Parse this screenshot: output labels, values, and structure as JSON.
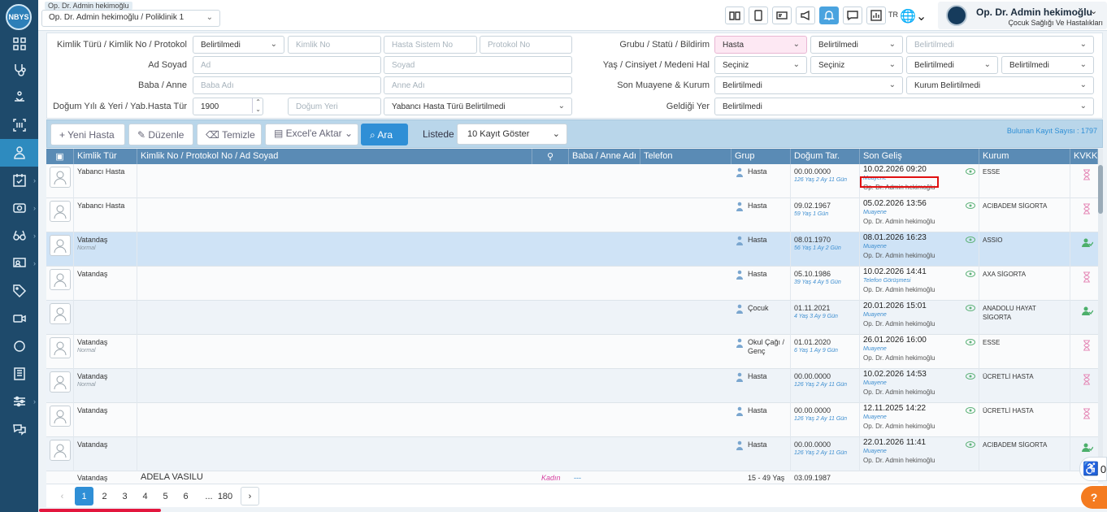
{
  "app": {
    "logo": "NBYS"
  },
  "topbar": {
    "crumb": "Op. Dr. Admin hekimoğlu",
    "poliklinik": "Op. Dr. Admin hekimoğlu / Poliklinik 1",
    "lang": "TR",
    "user_name": "Op. Dr. Admin hekimoğlu",
    "user_dept": "Çocuk Sağlığı Ve Hastalıkları"
  },
  "filters": {
    "lbl_kimlik": "Kimlik Türü / Kimlik No / Protokol",
    "lbl_adsoyad": "Ad Soyad",
    "lbl_baba": "Baba / Anne",
    "lbl_dogum": "Doğum Yılı & Yeri / Yab.Hasta Tür",
    "lbl_grubu": "Grubu / Statü / Bildirim",
    "lbl_yas": "Yaş / Cinsiyet / Medeni Hal",
    "lbl_muayene": "Son Muayene & Kurum",
    "lbl_geldigi": "Geldiği Yer",
    "kimlik_turu": "Belirtilmedi",
    "kimlik_no_ph": "Kimlik No",
    "hasta_sistem_ph": "Hasta Sistem No",
    "protokol_ph": "Protokol No",
    "ad_ph": "Ad",
    "soyad_ph": "Soyad",
    "baba_ph": "Baba Adı",
    "anne_ph": "Anne Adı",
    "dogum_yili": "1900",
    "dogum_yeri_ph": "Doğum Yeri",
    "yabanci_tur": "Yabancı Hasta Türü Belirtilmedi",
    "grubu": "Hasta",
    "statu": "Belirtilmedi",
    "bildirim": "Belirtilmedi",
    "yas": "Seçiniz",
    "cinsiyet": "Seçiniz",
    "medeni": "Belirtilmedi",
    "medeni2": "Belirtilmedi",
    "son_muayene": "Belirtilmedi",
    "kurum": "Kurum Belirtilmedi",
    "geldigi": "Belirtilmedi"
  },
  "toolbar": {
    "yeni": "Yeni Hasta",
    "duzenle": "Düzenle",
    "temizle": "Temizle",
    "excel": "Excel'e Aktar",
    "ara": "Ara",
    "listede": "Listede",
    "kayit": "10 Kayıt Göster",
    "found": "Bulunan Kayıt Sayısı : 1797"
  },
  "columns": [
    "Kimlik Tür",
    "Kimlik No / Protokol No / Ad Soyad",
    "Baba / Anne Adı",
    "Telefon",
    "Grup",
    "Doğum Tar.",
    "Son Geliş",
    "Kurum",
    "KVKK"
  ],
  "rows": [
    {
      "kimlik": "Yabancı Hasta",
      "sub": "",
      "grup": "Hasta",
      "dogum": "00.00.0000",
      "yas": "126 Yaş 2 Ay 11 Gün",
      "gelis": "10.02.2026 09:20",
      "tur": "Muayene",
      "doktor": "Op. Dr. Admin hekimoğlu",
      "kurum": "ESSE",
      "kvkk": "hourglass"
    },
    {
      "kimlik": "Yabancı Hasta",
      "sub": "",
      "grup": "Hasta",
      "dogum": "09.02.1967",
      "yas": "59 Yaş 1 Gün",
      "gelis": "05.02.2026 13:56",
      "tur": "Muayene",
      "doktor": "Op. Dr. Admin hekimoğlu",
      "kurum": "ACIBADEM SİGORTA",
      "kvkk": "hourglass"
    },
    {
      "kimlik": "Vatandaş",
      "sub": "Normal",
      "grup": "Hasta",
      "dogum": "08.01.1970",
      "yas": "56 Yaş 1 Ay 2 Gün",
      "gelis": "08.01.2026 16:23",
      "tur": "Muayene",
      "doktor": "Op. Dr. Admin hekimoğlu",
      "kurum": "ASSIO",
      "kvkk": "user-check"
    },
    {
      "kimlik": "Vatandaş",
      "sub": "",
      "grup": "Hasta",
      "dogum": "05.10.1986",
      "yas": "39 Yaş 4 Ay 5 Gün",
      "gelis": "10.02.2026 14:41",
      "tur": "Telefon Görüşmesi",
      "doktor": "Op. Dr. Admin hekimoğlu",
      "kurum": "AXA SİGORTA",
      "kvkk": "hourglass"
    },
    {
      "kimlik": "",
      "sub": "",
      "grup": "Çocuk",
      "dogum": "01.11.2021",
      "yas": "4 Yaş 3 Ay 9 Gün",
      "gelis": "20.01.2026 15:01",
      "tur": "Muayene",
      "doktor": "Op. Dr. Admin hekimoğlu",
      "kurum": "ANADOLU HAYAT SİGORTA",
      "kvkk": "user-check"
    },
    {
      "kimlik": "Vatandaş",
      "sub": "Normal",
      "grup": "Okul Çağı / Genç",
      "dogum": "01.01.2020",
      "yas": "6 Yaş 1 Ay 9 Gün",
      "gelis": "26.01.2026 16:00",
      "tur": "Muayene",
      "doktor": "Op. Dr. Admin hekimoğlu",
      "kurum": "ESSE",
      "kvkk": "hourglass"
    },
    {
      "kimlik": "Vatandaş",
      "sub": "Normal",
      "grup": "Hasta",
      "dogum": "00.00.0000",
      "yas": "126 Yaş 2 Ay 11 Gün",
      "gelis": "10.02.2026 14:53",
      "tur": "Muayene",
      "doktor": "Op. Dr. Admin hekimoğlu",
      "kurum": "ÜCRETLİ HASTA",
      "kvkk": "hourglass"
    },
    {
      "kimlik": "Vatandaş",
      "sub": "",
      "grup": "Hasta",
      "dogum": "00.00.0000",
      "yas": "126 Yaş 2 Ay 11 Gün",
      "gelis": "12.11.2025 14:22",
      "tur": "Muayene",
      "doktor": "Op. Dr. Admin hekimoğlu",
      "kurum": "ÜCRETLİ HASTA",
      "kvkk": "hourglass"
    },
    {
      "kimlik": "Vatandaş",
      "sub": "",
      "grup": "Hasta",
      "dogum": "00.00.0000",
      "yas": "126 Yaş 2 Ay 11 Gün",
      "gelis": "22.01.2026 11:41",
      "tur": "Muayene",
      "doktor": "Op. Dr. Admin hekimoğlu",
      "kurum": "ACIBADEM SİGORTA",
      "kvkk": "user-check"
    }
  ],
  "partial_row": {
    "kimlik": "Vatandaş",
    "name": "ADELA VASILU",
    "cinsiyet": "Kadın",
    "baba": "---",
    "grup": "15 - 49 Yaş",
    "dogum": "03.09.1987"
  },
  "pager": {
    "pages": [
      "1",
      "2",
      "3",
      "4",
      "5",
      "6",
      "...",
      "180"
    ],
    "current": "1"
  },
  "float_count": "0",
  "help": "?"
}
